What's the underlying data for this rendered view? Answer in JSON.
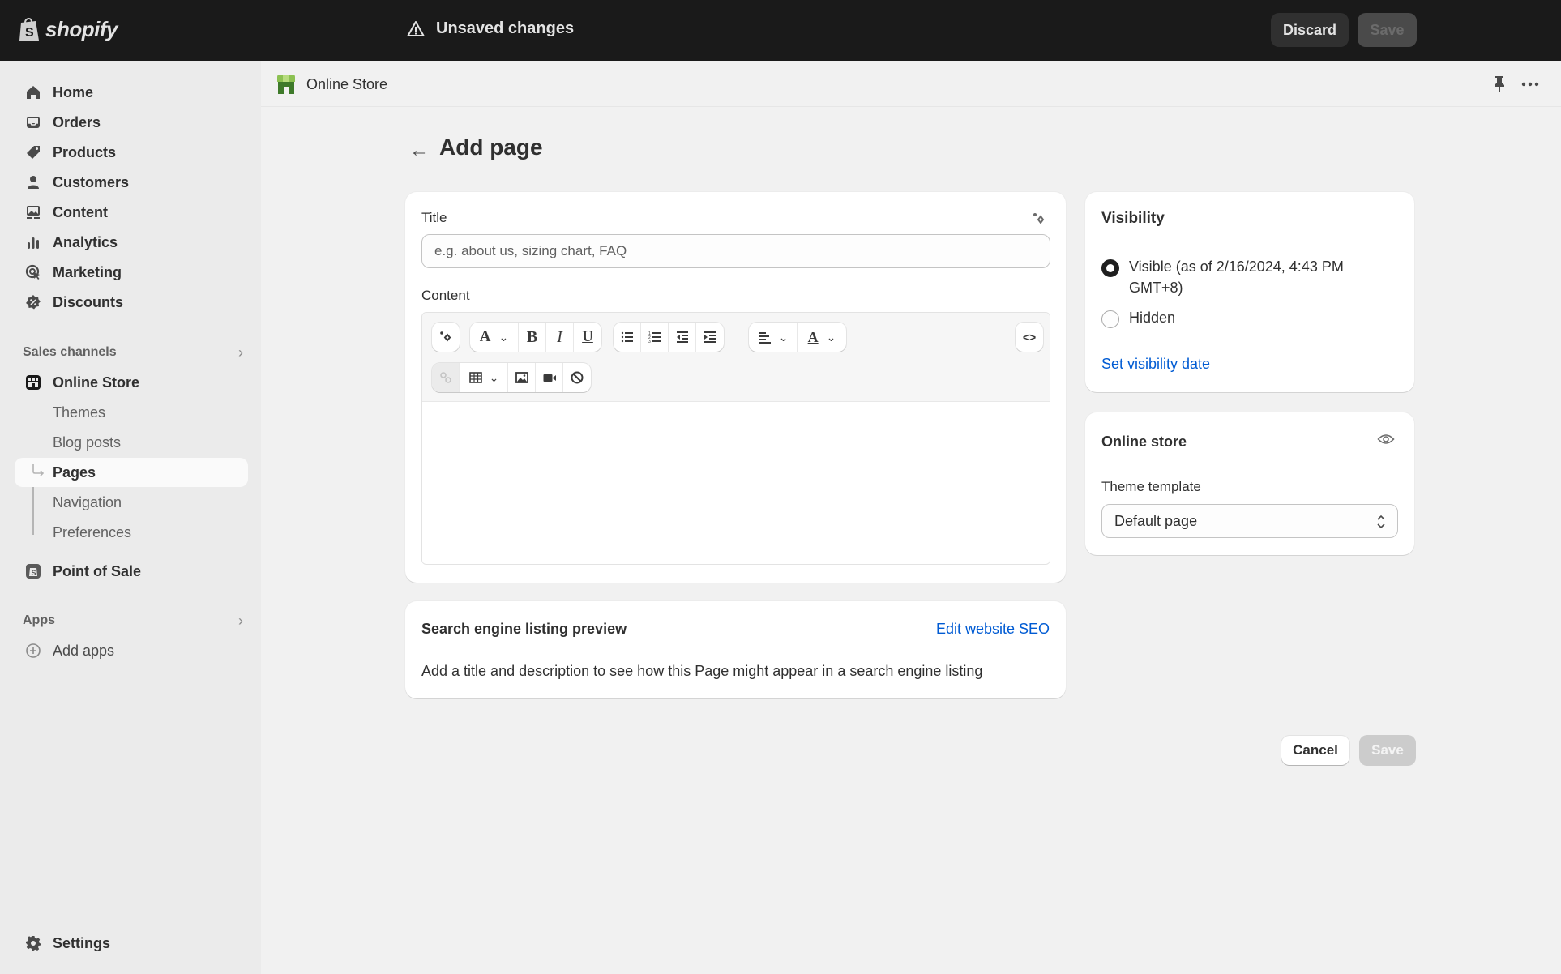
{
  "topbar": {
    "brand": "shopify",
    "status": "Unsaved changes",
    "discard_label": "Discard",
    "save_label": "Save"
  },
  "sidebar": {
    "items": [
      {
        "label": "Home",
        "icon": "home-icon"
      },
      {
        "label": "Orders",
        "icon": "inbox-icon"
      },
      {
        "label": "Products",
        "icon": "tag-icon"
      },
      {
        "label": "Customers",
        "icon": "person-icon"
      },
      {
        "label": "Content",
        "icon": "image-icon"
      },
      {
        "label": "Analytics",
        "icon": "bar-chart-icon"
      },
      {
        "label": "Marketing",
        "icon": "target-icon"
      },
      {
        "label": "Discounts",
        "icon": "discount-icon"
      }
    ],
    "sales_channels_label": "Sales channels",
    "online_store_label": "Online Store",
    "online_store_sub": [
      {
        "label": "Themes"
      },
      {
        "label": "Blog posts"
      },
      {
        "label": "Pages",
        "active": true
      },
      {
        "label": "Navigation"
      },
      {
        "label": "Preferences"
      }
    ],
    "pos_label": "Point of Sale",
    "apps_label": "Apps",
    "add_apps_label": "Add apps",
    "settings_label": "Settings"
  },
  "content_header": {
    "store_label": "Online Store"
  },
  "page": {
    "title": "Add page"
  },
  "main_card": {
    "title_label": "Title",
    "title_placeholder": "e.g. about us, sizing chart, FAQ",
    "title_value": "",
    "content_label": "Content",
    "toolbar": {
      "row1": [
        "ai-generate",
        "text-format",
        "bold",
        "italic",
        "underline",
        "bullet-list",
        "numbered-list",
        "outdent",
        "indent",
        "align",
        "text-color"
      ],
      "row2": [
        "link (disabled)",
        "table",
        "image",
        "video",
        "clear-format"
      ],
      "html_toggle": "<>"
    }
  },
  "seo_card": {
    "title": "Search engine listing preview",
    "link": "Edit website SEO",
    "description": "Add a title and description to see how this Page might appear in a search engine listing"
  },
  "visibility_card": {
    "title": "Visibility",
    "options": [
      {
        "label": "Visible (as of 2/16/2024, 4:43 PM GMT+8)",
        "checked": true
      },
      {
        "label": "Hidden",
        "checked": false
      }
    ],
    "link": "Set visibility date"
  },
  "online_store_card": {
    "title": "Online store",
    "template_label": "Theme template",
    "template_value": "Default page"
  },
  "footer": {
    "cancel_label": "Cancel",
    "save_label": "Save"
  },
  "colors": {
    "topbar_bg": "#1a1a1a",
    "sidebar_bg": "#ebebeb",
    "page_bg": "#f1f1f1",
    "link": "#005bd3",
    "save_disabled": "#cccccc"
  }
}
